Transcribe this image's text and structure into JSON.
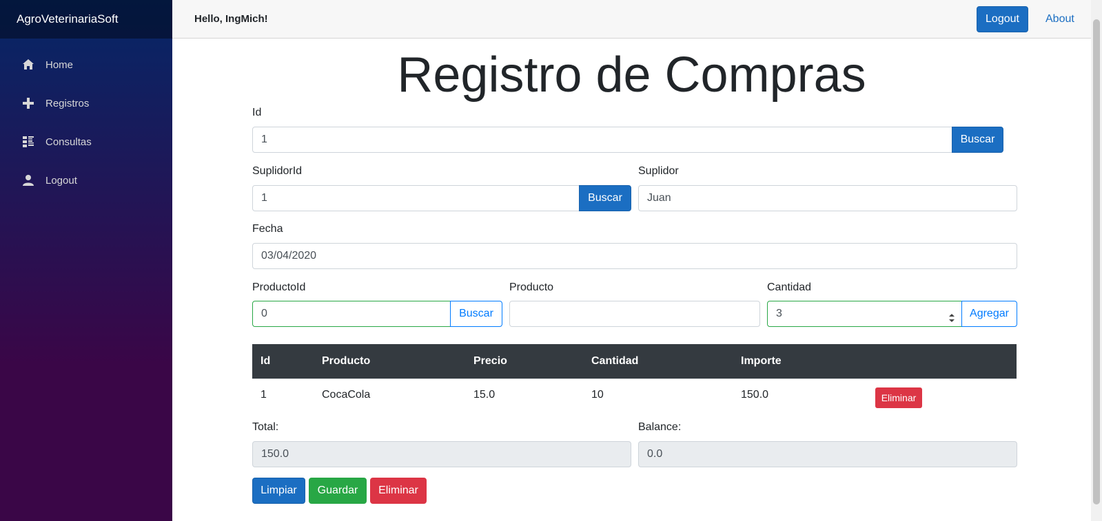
{
  "sidebar": {
    "brand": "AgroVeterinariaSoft",
    "items": [
      {
        "label": "Home",
        "icon": "home-icon"
      },
      {
        "label": "Registros",
        "icon": "plus-icon"
      },
      {
        "label": "Consultas",
        "icon": "list-icon"
      },
      {
        "label": "Logout",
        "icon": "person-icon"
      }
    ]
  },
  "topbar": {
    "greeting": "Hello, IngMich!",
    "logout_label": "Logout",
    "about_label": "About"
  },
  "page": {
    "title": "Registro de Compras"
  },
  "form": {
    "id_label": "Id",
    "id_value": "1",
    "id_search": "Buscar",
    "suplidor_id_label": "SuplidorId",
    "suplidor_id_value": "1",
    "suplidor_search": "Buscar",
    "suplidor_label": "Suplidor",
    "suplidor_value": "Juan",
    "fecha_label": "Fecha",
    "fecha_value": "03/04/2020",
    "producto_id_label": "ProductoId",
    "producto_id_value": "0",
    "producto_search": "Buscar",
    "producto_label": "Producto",
    "producto_value": "",
    "cantidad_label": "Cantidad",
    "cantidad_value": "3",
    "agregar_label": "Agregar"
  },
  "table": {
    "headers": [
      "Id",
      "Producto",
      "Precio",
      "Cantidad",
      "Importe"
    ],
    "rows": [
      {
        "id": "1",
        "producto": "CocaCola",
        "precio": "15.0",
        "cantidad": "10",
        "importe": "150.0",
        "action": "Eliminar"
      }
    ]
  },
  "totals": {
    "total_label": "Total:",
    "total_value": "150.0",
    "balance_label": "Balance:",
    "balance_value": "0.0"
  },
  "actions": {
    "limpiar": "Limpiar",
    "guardar": "Guardar",
    "eliminar": "Eliminar"
  }
}
